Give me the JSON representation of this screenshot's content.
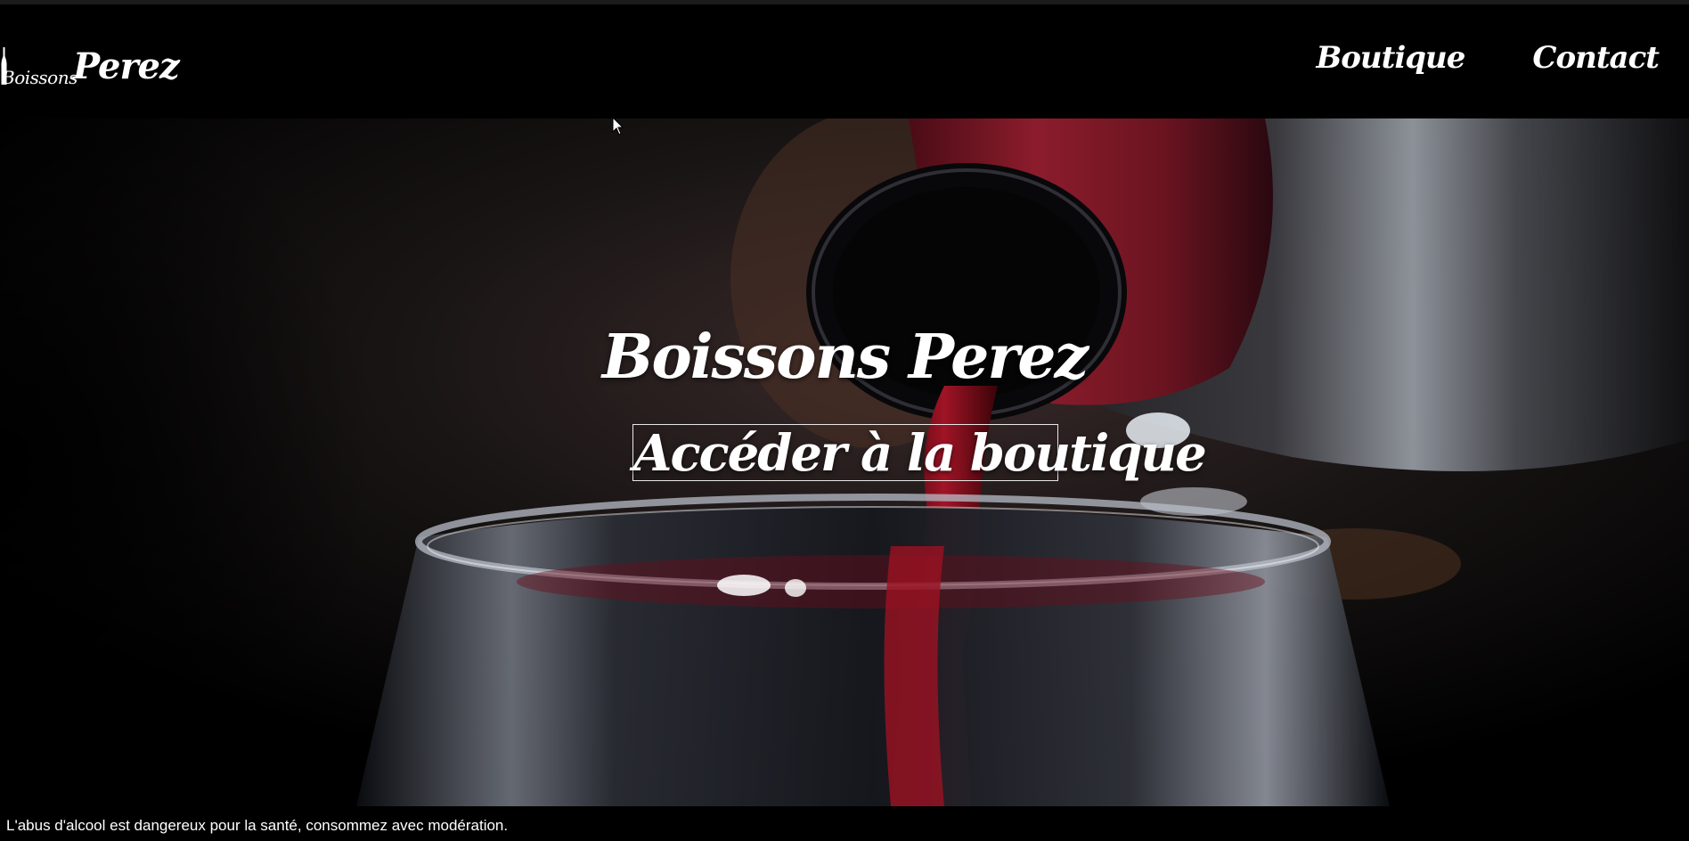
{
  "header": {
    "logo": {
      "line1": "Boissons",
      "line2": "Perez"
    },
    "nav": [
      {
        "label": "Boutique"
      },
      {
        "label": "Contact"
      }
    ]
  },
  "hero": {
    "title": "Boissons Perez",
    "cta_label": "Accéder à la boutique",
    "background_image": "wine-being-poured-from-bottle-into-glass"
  },
  "footer": {
    "warning": "L'abus d'alcool est dangereux pour la santé, consommez avec modération."
  },
  "colors": {
    "background": "#000000",
    "text": "#ffffff",
    "wine": "#8c1020",
    "bottle_foil": "#7a1a28"
  }
}
